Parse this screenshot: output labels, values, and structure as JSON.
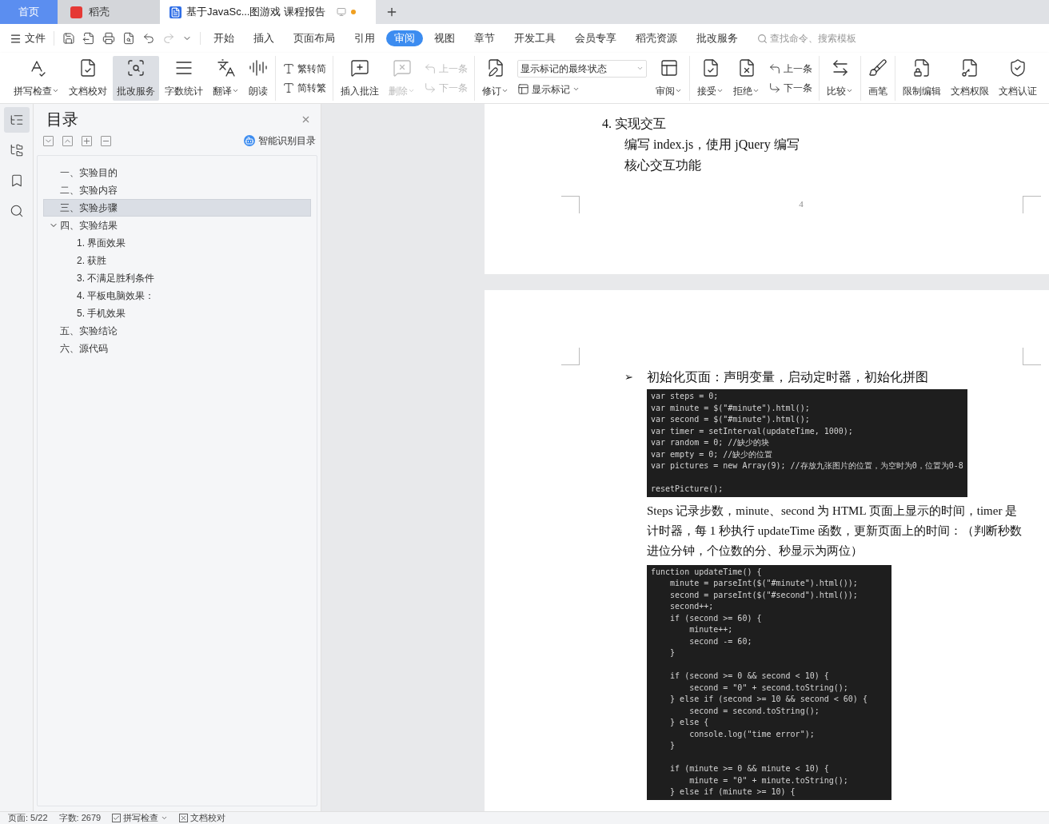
{
  "tabs": [
    {
      "kind": "home",
      "label": "首页",
      "selected": false
    },
    {
      "kind": "app",
      "label": "稻壳",
      "selected": false
    },
    {
      "kind": "doc",
      "label": "基于JavaSc...图游戏 课程报告",
      "selected": true,
      "unsaved": true
    }
  ],
  "file_menu": "文件",
  "menu_tabs": [
    {
      "label": "开始",
      "selected": false
    },
    {
      "label": "插入",
      "selected": false
    },
    {
      "label": "页面布局",
      "selected": false
    },
    {
      "label": "引用",
      "selected": false
    },
    {
      "label": "审阅",
      "selected": true
    },
    {
      "label": "视图",
      "selected": false
    },
    {
      "label": "章节",
      "selected": false
    },
    {
      "label": "开发工具",
      "selected": false
    },
    {
      "label": "会员专享",
      "selected": false
    },
    {
      "label": "稻壳资源",
      "selected": false
    },
    {
      "label": "批改服务",
      "selected": false
    }
  ],
  "command_search": {
    "placeholder": "查找命令、搜索模板"
  },
  "ribbon": [
    {
      "items": [
        {
          "kind": "large",
          "label": "拼写检查",
          "dropdown": true,
          "disabled": false,
          "selected": false
        },
        {
          "kind": "large",
          "label": "文档校对",
          "dropdown": false,
          "disabled": false,
          "selected": false
        },
        {
          "kind": "large",
          "label": "批改服务",
          "dropdown": false,
          "disabled": false,
          "selected": true
        },
        {
          "kind": "large",
          "label": "字数统计",
          "dropdown": false,
          "disabled": false,
          "selected": false
        },
        {
          "kind": "large",
          "label": "翻译",
          "dropdown": true,
          "disabled": false,
          "selected": false
        },
        {
          "kind": "large",
          "label": "朗读",
          "dropdown": false,
          "disabled": false,
          "selected": false
        }
      ]
    },
    {
      "items": [
        {
          "kind": "stack",
          "rows": [
            {
              "label": "繁转简",
              "disabled": false
            },
            {
              "label": "简转繁",
              "disabled": false
            }
          ]
        }
      ]
    },
    {
      "items": [
        {
          "kind": "large",
          "label": "插入批注",
          "dropdown": false,
          "disabled": false,
          "selected": false
        },
        {
          "kind": "large",
          "label": "删除",
          "dropdown": true,
          "disabled": true,
          "selected": false
        },
        {
          "kind": "stack",
          "rows": [
            {
              "label": "上一条",
              "disabled": true
            },
            {
              "label": "下一条",
              "disabled": true
            }
          ]
        }
      ]
    },
    {
      "items": [
        {
          "kind": "large",
          "label": "修订",
          "dropdown": true,
          "disabled": false,
          "selected": false
        },
        {
          "kind": "select",
          "value": "显示标记的最终状态",
          "toggle": "显示标记"
        },
        {
          "kind": "large",
          "label": "审阅",
          "dropdown": true,
          "disabled": false,
          "selected": false
        }
      ]
    },
    {
      "items": [
        {
          "kind": "large",
          "label": "接受",
          "dropdown": true,
          "disabled": false,
          "selected": false
        },
        {
          "kind": "large",
          "label": "拒绝",
          "dropdown": true,
          "disabled": false,
          "selected": false
        },
        {
          "kind": "stack",
          "rows": [
            {
              "label": "上一条",
              "disabled": false
            },
            {
              "label": "下一条",
              "disabled": false
            }
          ]
        }
      ]
    },
    {
      "items": [
        {
          "kind": "large",
          "label": "比较",
          "dropdown": true,
          "disabled": false,
          "selected": false
        }
      ]
    },
    {
      "items": [
        {
          "kind": "large",
          "label": "画笔",
          "dropdown": false,
          "disabled": false,
          "selected": false
        }
      ]
    },
    {
      "items": [
        {
          "kind": "large",
          "label": "限制编辑",
          "dropdown": false,
          "disabled": false,
          "selected": false
        },
        {
          "kind": "large",
          "label": "文档权限",
          "dropdown": false,
          "disabled": false,
          "selected": false
        },
        {
          "kind": "large",
          "label": "文档认证",
          "dropdown": false,
          "disabled": false,
          "selected": false
        }
      ]
    }
  ],
  "nav_rail": [
    {
      "selected": true
    },
    {
      "selected": false
    },
    {
      "selected": false
    },
    {
      "selected": false
    }
  ],
  "toc": {
    "title": "目录",
    "smart_button": "智能识别目录",
    "items": [
      {
        "label": "一、实验目的",
        "selected": false
      },
      {
        "label": "二、实验内容",
        "selected": false
      },
      {
        "label": "三、实验步骤",
        "selected": true
      },
      {
        "label": "四、实验结果",
        "selected": false,
        "expanded": true,
        "children": [
          {
            "label": "1. 界面效果",
            "selected": false
          },
          {
            "label": "2. 获胜",
            "selected": false
          },
          {
            "label": "3. 不满足胜利条件",
            "selected": false
          },
          {
            "label": "4. 平板电脑效果：",
            "selected": false
          },
          {
            "label": "5. 手机效果",
            "selected": false
          }
        ]
      },
      {
        "label": "五、实验结论",
        "selected": false
      },
      {
        "label": "六、源代码",
        "selected": false
      }
    ]
  },
  "pages": [
    {
      "blocks": [
        {
          "kind": "numbered",
          "number": "4.",
          "text": "实现交互"
        },
        {
          "kind": "indented",
          "text": "编写 index.js，使用 jQuery 编写"
        },
        {
          "kind": "indented",
          "text": "核心交互功能"
        }
      ],
      "page_number": "4"
    },
    {
      "blocks": [
        {
          "kind": "bullet",
          "marker": "➢",
          "text": "初始化页面：声明变量，启动定时器，初始化拼图"
        },
        {
          "kind": "code",
          "sections": [
            [
              "var steps = 0;",
              "var minute = $(\"#minute\").html();",
              "var second = $(\"#minute\").html();",
              "var timer = setInterval(updateTime, 1000);",
              "var random = 0; //缺少的块",
              "var empty = 0; //缺少的位置",
              "var pictures = new Array(9); //存放九张图片的位置，为空时为0，位置为0-8"
            ],
            [
              "resetPicture();"
            ]
          ]
        },
        {
          "kind": "paragraph",
          "text": "Steps 记录步数，minute、second 为 HTML 页面上显示的时间，timer 是计时器，每 1 秒执行 updateTime 函数，更新页面上的时间：（判断秒数进位分钟，个位数的分、秒显示为两位）"
        },
        {
          "kind": "code",
          "sections": [
            [
              "function updateTime() {",
              "    minute = parseInt($(\"#minute\").html());",
              "    second = parseInt($(\"#second\").html());",
              "    second++;",
              "    if (second >= 60) {",
              "        minute++;",
              "        second -= 60;",
              "    }"
            ],
            [
              "    if (second >= 0 && second < 10) {",
              "        second = \"0\" + second.toString();",
              "    } else if (second >= 10 && second < 60) {",
              "        second = second.toString();",
              "    } else {",
              "        console.log(\"time error\");",
              "    }"
            ],
            [
              "    if (minute >= 0 && minute < 10) {",
              "        minute = \"0\" + minute.toString();",
              "    } else if (minute >= 10) {"
            ]
          ]
        }
      ]
    }
  ],
  "status_bar": {
    "page": "页面: 5/22",
    "words": "字数: 2679",
    "spell_check": {
      "label": "拼写检查",
      "checked": true
    },
    "proofread": "文档校对"
  }
}
